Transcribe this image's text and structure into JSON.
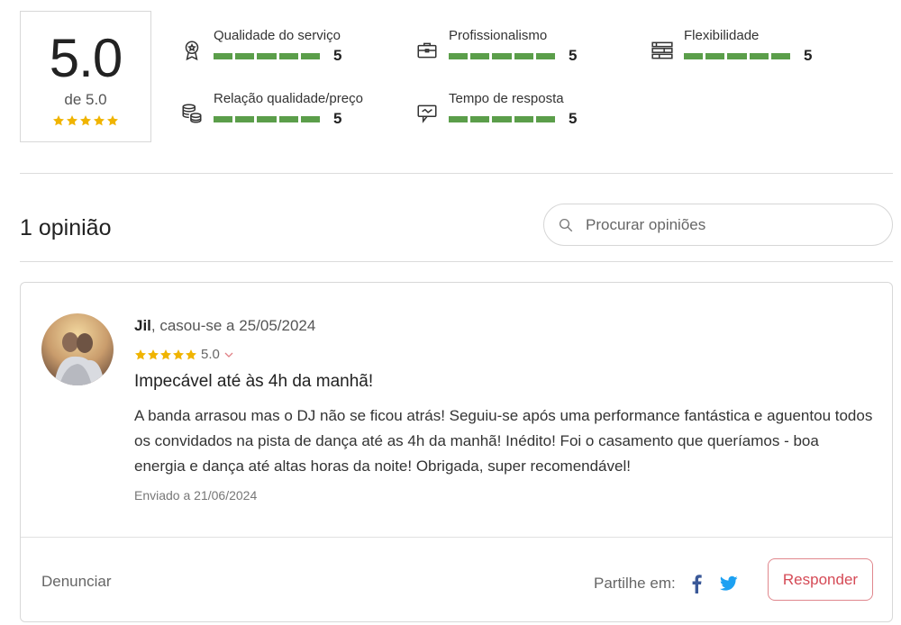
{
  "summary": {
    "score": "5.0",
    "out_of": "de 5.0",
    "stars": 5,
    "star_color": "#f0b400"
  },
  "ratings": [
    {
      "label": "Qualidade do serviço",
      "value": "5",
      "icon": "award-icon"
    },
    {
      "label": "Profissionalismo",
      "value": "5",
      "icon": "briefcase-icon"
    },
    {
      "label": "Flexibilidade",
      "value": "5",
      "icon": "layers-icon"
    },
    {
      "label": "Relação qualidade/preço",
      "value": "5",
      "icon": "coins-icon"
    },
    {
      "label": "Tempo de resposta",
      "value": "5",
      "icon": "chat-icon"
    }
  ],
  "bar_color": "#5b9e4a",
  "reviews_header": {
    "count_title": "1 opinião",
    "search_placeholder": "Procurar opiniões"
  },
  "review": {
    "author_name": "Jil",
    "author_meta": ", casou-se a 25/05/2024",
    "rating": "5.0",
    "stars": 5,
    "title": "Impecável até às 4h da manhã!",
    "body": "A banda arrasou mas o DJ não se ficou atrás! Seguiu-se após uma performance fantástica e aguentou todos os convidados na pista de dança até as 4h da manhã! Inédito! Foi o casamento que queríamos - boa energia e dança até altas horas da noite! Obrigada, super recomendável!",
    "sent_date": "Enviado a 21/06/2024",
    "report_label": "Denunciar",
    "share_label": "Partilhe em:",
    "reply_label": "Responder"
  },
  "colors": {
    "accent": "#d54a56",
    "facebook": "#3b5998",
    "twitter": "#1da1f2"
  }
}
